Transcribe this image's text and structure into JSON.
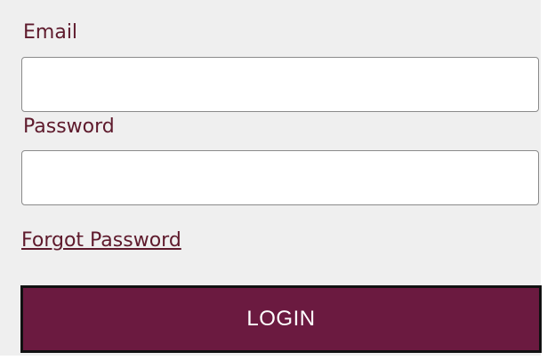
{
  "form": {
    "email_label": "Email",
    "email_value": "",
    "password_label": "Password",
    "password_value": "",
    "forgot_password_link": "Forgot Password",
    "login_button": "LOGIN"
  },
  "colors": {
    "panel_background": "#efefef",
    "label_text": "#5e1a2c",
    "login_button_background": "#6b1a40",
    "login_button_text": "#ffffff"
  }
}
